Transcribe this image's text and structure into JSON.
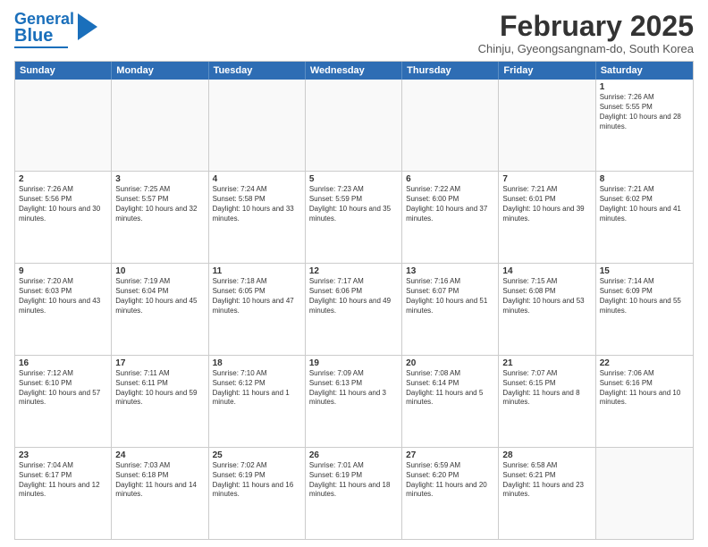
{
  "header": {
    "logo_line1": "General",
    "logo_line2": "Blue",
    "month_title": "February 2025",
    "subtitle": "Chinju, Gyeongsangnam-do, South Korea"
  },
  "days_of_week": [
    "Sunday",
    "Monday",
    "Tuesday",
    "Wednesday",
    "Thursday",
    "Friday",
    "Saturday"
  ],
  "weeks": [
    [
      {
        "day": "",
        "info": ""
      },
      {
        "day": "",
        "info": ""
      },
      {
        "day": "",
        "info": ""
      },
      {
        "day": "",
        "info": ""
      },
      {
        "day": "",
        "info": ""
      },
      {
        "day": "",
        "info": ""
      },
      {
        "day": "1",
        "info": "Sunrise: 7:26 AM\nSunset: 5:55 PM\nDaylight: 10 hours and 28 minutes."
      }
    ],
    [
      {
        "day": "2",
        "info": "Sunrise: 7:26 AM\nSunset: 5:56 PM\nDaylight: 10 hours and 30 minutes."
      },
      {
        "day": "3",
        "info": "Sunrise: 7:25 AM\nSunset: 5:57 PM\nDaylight: 10 hours and 32 minutes."
      },
      {
        "day": "4",
        "info": "Sunrise: 7:24 AM\nSunset: 5:58 PM\nDaylight: 10 hours and 33 minutes."
      },
      {
        "day": "5",
        "info": "Sunrise: 7:23 AM\nSunset: 5:59 PM\nDaylight: 10 hours and 35 minutes."
      },
      {
        "day": "6",
        "info": "Sunrise: 7:22 AM\nSunset: 6:00 PM\nDaylight: 10 hours and 37 minutes."
      },
      {
        "day": "7",
        "info": "Sunrise: 7:21 AM\nSunset: 6:01 PM\nDaylight: 10 hours and 39 minutes."
      },
      {
        "day": "8",
        "info": "Sunrise: 7:21 AM\nSunset: 6:02 PM\nDaylight: 10 hours and 41 minutes."
      }
    ],
    [
      {
        "day": "9",
        "info": "Sunrise: 7:20 AM\nSunset: 6:03 PM\nDaylight: 10 hours and 43 minutes."
      },
      {
        "day": "10",
        "info": "Sunrise: 7:19 AM\nSunset: 6:04 PM\nDaylight: 10 hours and 45 minutes."
      },
      {
        "day": "11",
        "info": "Sunrise: 7:18 AM\nSunset: 6:05 PM\nDaylight: 10 hours and 47 minutes."
      },
      {
        "day": "12",
        "info": "Sunrise: 7:17 AM\nSunset: 6:06 PM\nDaylight: 10 hours and 49 minutes."
      },
      {
        "day": "13",
        "info": "Sunrise: 7:16 AM\nSunset: 6:07 PM\nDaylight: 10 hours and 51 minutes."
      },
      {
        "day": "14",
        "info": "Sunrise: 7:15 AM\nSunset: 6:08 PM\nDaylight: 10 hours and 53 minutes."
      },
      {
        "day": "15",
        "info": "Sunrise: 7:14 AM\nSunset: 6:09 PM\nDaylight: 10 hours and 55 minutes."
      }
    ],
    [
      {
        "day": "16",
        "info": "Sunrise: 7:12 AM\nSunset: 6:10 PM\nDaylight: 10 hours and 57 minutes."
      },
      {
        "day": "17",
        "info": "Sunrise: 7:11 AM\nSunset: 6:11 PM\nDaylight: 10 hours and 59 minutes."
      },
      {
        "day": "18",
        "info": "Sunrise: 7:10 AM\nSunset: 6:12 PM\nDaylight: 11 hours and 1 minute."
      },
      {
        "day": "19",
        "info": "Sunrise: 7:09 AM\nSunset: 6:13 PM\nDaylight: 11 hours and 3 minutes."
      },
      {
        "day": "20",
        "info": "Sunrise: 7:08 AM\nSunset: 6:14 PM\nDaylight: 11 hours and 5 minutes."
      },
      {
        "day": "21",
        "info": "Sunrise: 7:07 AM\nSunset: 6:15 PM\nDaylight: 11 hours and 8 minutes."
      },
      {
        "day": "22",
        "info": "Sunrise: 7:06 AM\nSunset: 6:16 PM\nDaylight: 11 hours and 10 minutes."
      }
    ],
    [
      {
        "day": "23",
        "info": "Sunrise: 7:04 AM\nSunset: 6:17 PM\nDaylight: 11 hours and 12 minutes."
      },
      {
        "day": "24",
        "info": "Sunrise: 7:03 AM\nSunset: 6:18 PM\nDaylight: 11 hours and 14 minutes."
      },
      {
        "day": "25",
        "info": "Sunrise: 7:02 AM\nSunset: 6:19 PM\nDaylight: 11 hours and 16 minutes."
      },
      {
        "day": "26",
        "info": "Sunrise: 7:01 AM\nSunset: 6:19 PM\nDaylight: 11 hours and 18 minutes."
      },
      {
        "day": "27",
        "info": "Sunrise: 6:59 AM\nSunset: 6:20 PM\nDaylight: 11 hours and 20 minutes."
      },
      {
        "day": "28",
        "info": "Sunrise: 6:58 AM\nSunset: 6:21 PM\nDaylight: 11 hours and 23 minutes."
      },
      {
        "day": "",
        "info": ""
      }
    ]
  ]
}
